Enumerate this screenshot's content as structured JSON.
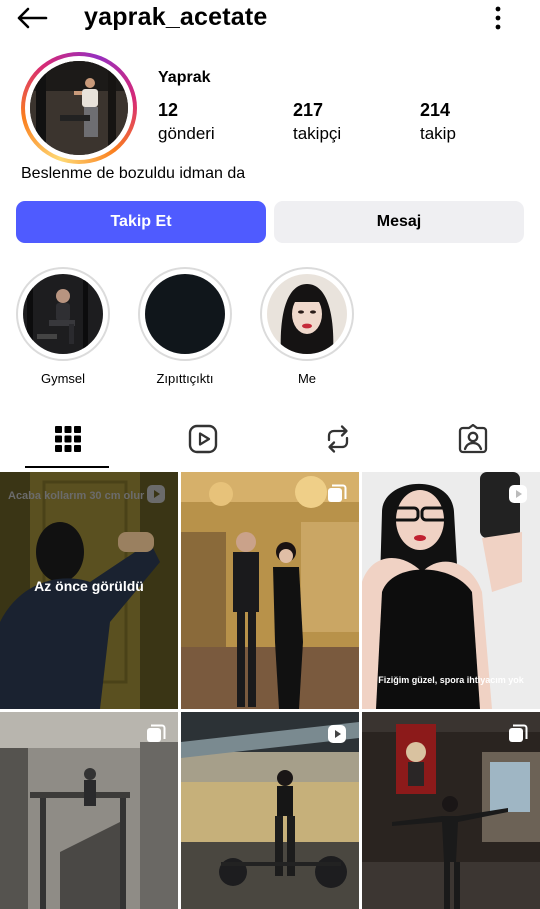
{
  "header": {
    "username": "yaprak_acetate",
    "back_icon": "arrow-left-icon",
    "more_icon": "more-vertical-icon"
  },
  "profile": {
    "display_name": "Yaprak",
    "bio": "Beslenme de bozuldu idman da",
    "stats": [
      {
        "value": "12",
        "label": "gönderi"
      },
      {
        "value": "217",
        "label": "takipçi"
      },
      {
        "value": "214",
        "label": "takip"
      }
    ]
  },
  "actions": {
    "follow_label": "Takip Et",
    "message_label": "Mesaj"
  },
  "highlights": [
    {
      "label": "Gymsel"
    },
    {
      "label": "Zıpıttıçıktı"
    },
    {
      "label": "Me"
    }
  ],
  "tabs": [
    {
      "icon": "grid-icon",
      "active": true
    },
    {
      "icon": "reels-icon",
      "active": false
    },
    {
      "icon": "reposts-icon",
      "active": false
    },
    {
      "icon": "tagged-icon",
      "active": false
    }
  ],
  "posts": [
    {
      "caption_top": "Acaba kollarım 30 cm olur mu",
      "overlay": "Az önce görüldü",
      "type": "reel"
    },
    {
      "type": "carousel"
    },
    {
      "caption_bottom": "Fiziğim güzel, spora ihtiyacım yok",
      "type": "reel"
    },
    {
      "type": "carousel"
    },
    {
      "type": "reel"
    },
    {
      "type": "carousel"
    }
  ],
  "colors": {
    "follow_button": "#4f5bff",
    "message_button": "#efeff2",
    "story_ring": [
      "#feda75",
      "#fa7e1e",
      "#d62976",
      "#962fbf"
    ]
  }
}
